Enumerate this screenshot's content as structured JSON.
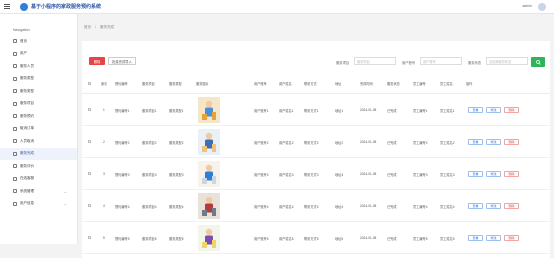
{
  "header": {
    "title": "基于小程序的家政服务预约系统",
    "user": "admin"
  },
  "sidebar": {
    "heading": "Navigation",
    "items": [
      {
        "label": "首页",
        "icon": "home-icon"
      },
      {
        "label": "用户",
        "icon": "user-icon"
      },
      {
        "label": "服务人员",
        "icon": "staff-icon"
      },
      {
        "label": "服务类型",
        "icon": "type-icon"
      },
      {
        "label": "服务类型",
        "icon": "type-icon"
      },
      {
        "label": "服务项目",
        "icon": "project-icon"
      },
      {
        "label": "服务预约",
        "icon": "calendar-icon"
      },
      {
        "label": "取消订单",
        "icon": "cancel-icon"
      },
      {
        "label": "人员取消",
        "icon": "cancel-icon"
      },
      {
        "label": "服务完成",
        "icon": "check-icon",
        "active": true
      },
      {
        "label": "服务评价",
        "icon": "comment-icon"
      },
      {
        "label": "在线客服",
        "icon": "chat-icon"
      },
      {
        "label": "系统管理",
        "icon": "settings-icon",
        "sub": true
      },
      {
        "label": "用户信息",
        "icon": "info-icon",
        "sub": true
      }
    ]
  },
  "breadcrumb": {
    "home": "首页",
    "sep": "/",
    "current": "服务完成"
  },
  "toolbar": {
    "delete_label": "删除",
    "import_label": "批量完成导入"
  },
  "filters": [
    {
      "label": "服务项目",
      "placeholder": "服务项目"
    },
    {
      "label": "用户账号",
      "placeholder": "用户账号"
    },
    {
      "label": "服务状态",
      "placeholder": "请选择服务状态"
    }
  ],
  "table": {
    "columns": [
      "索引",
      "预约编号",
      "服务项目",
      "服务类型",
      "服务图片",
      "用户账号",
      "用户姓名",
      "联系方式",
      "地址",
      "完成时间",
      "服务状态",
      "员工编号",
      "员工姓名",
      "操作"
    ],
    "rows": [
      {
        "index": "1",
        "order": "预约编号1",
        "project": "服务项目1",
        "type": "服务类型1",
        "account": "用户账号1",
        "name": "用户姓名1",
        "phone": "联系方式1",
        "addr": "地址1",
        "time": "2024-01-08",
        "status": "已完成",
        "eid": "员工编号1",
        "ename": "员工姓名1"
      },
      {
        "index": "2",
        "order": "预约编号2",
        "project": "服务项目2",
        "type": "服务类型2",
        "account": "用户账号2",
        "name": "用户姓名2",
        "phone": "联系方式2",
        "addr": "地址2",
        "time": "2024-01-08",
        "status": "已完成",
        "eid": "员工编号2",
        "ename": "员工姓名2"
      },
      {
        "index": "3",
        "order": "预约编号3",
        "project": "服务项目3",
        "type": "服务类型3",
        "account": "用户账号3",
        "name": "用户姓名3",
        "phone": "联系方式3",
        "addr": "地址3",
        "time": "2024-01-08",
        "status": "已完成",
        "eid": "员工编号3",
        "ename": "员工姓名3"
      },
      {
        "index": "4",
        "order": "预约编号4",
        "project": "服务项目4",
        "type": "服务类型4",
        "account": "用户账号4",
        "name": "用户姓名4",
        "phone": "联系方式4",
        "addr": "地址4",
        "time": "2024-01-08",
        "status": "已完成",
        "eid": "员工编号4",
        "ename": "员工姓名4"
      },
      {
        "index": "5",
        "order": "预约编号5",
        "project": "服务项目5",
        "type": "服务类型5",
        "account": "用户账号5",
        "name": "用户姓名5",
        "phone": "联系方式5",
        "addr": "地址5",
        "time": "2024-01-08",
        "status": "已完成",
        "eid": "员工编号5",
        "ename": "员工姓名5"
      }
    ],
    "actions": {
      "view": "查看",
      "edit": "修改",
      "delete": "删除"
    }
  },
  "colors": {
    "brand": "#2c59a8",
    "danger": "#e64545",
    "success": "#2fb45a"
  }
}
